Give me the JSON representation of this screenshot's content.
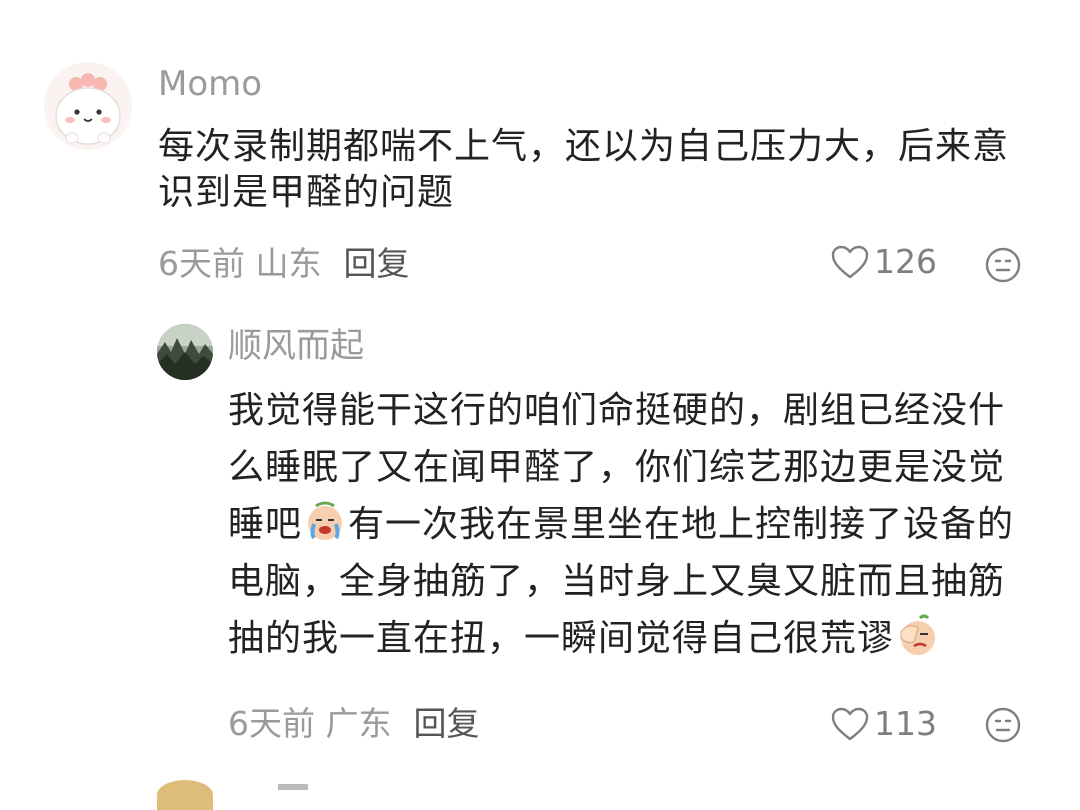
{
  "comments": [
    {
      "username": "Momo",
      "content": "每次录制期都喘不上气，还以为自己压力大，后来意识到是甲醛的问题",
      "time_location": "6天前 山东",
      "reply_label": "回复",
      "likes": "126",
      "avatar_icon": "cartoon-avatar-icon"
    },
    {
      "username": "顺风而起",
      "content_part1": "我觉得能干这行的咱们命挺硬的，剧组已经没什么睡眠了又在闻甲醛了，你们综艺那边更是没觉睡吧",
      "content_part2": "有一次我在景里坐在地上控制接了设备的电脑，全身抽筋了，当时身上又臭又脏而且抽筋抽的我一直在扭，一瞬间觉得自己很荒谬",
      "time_location": "6天前 广东",
      "reply_label": "回复",
      "likes": "113",
      "avatar_icon": "forest-avatar-icon",
      "emoji1": "crying-emoji",
      "emoji2": "facepalm-emoji"
    }
  ],
  "colors": {
    "meta": "#9a9a9a",
    "text": "#222222",
    "reply": "#555555"
  }
}
